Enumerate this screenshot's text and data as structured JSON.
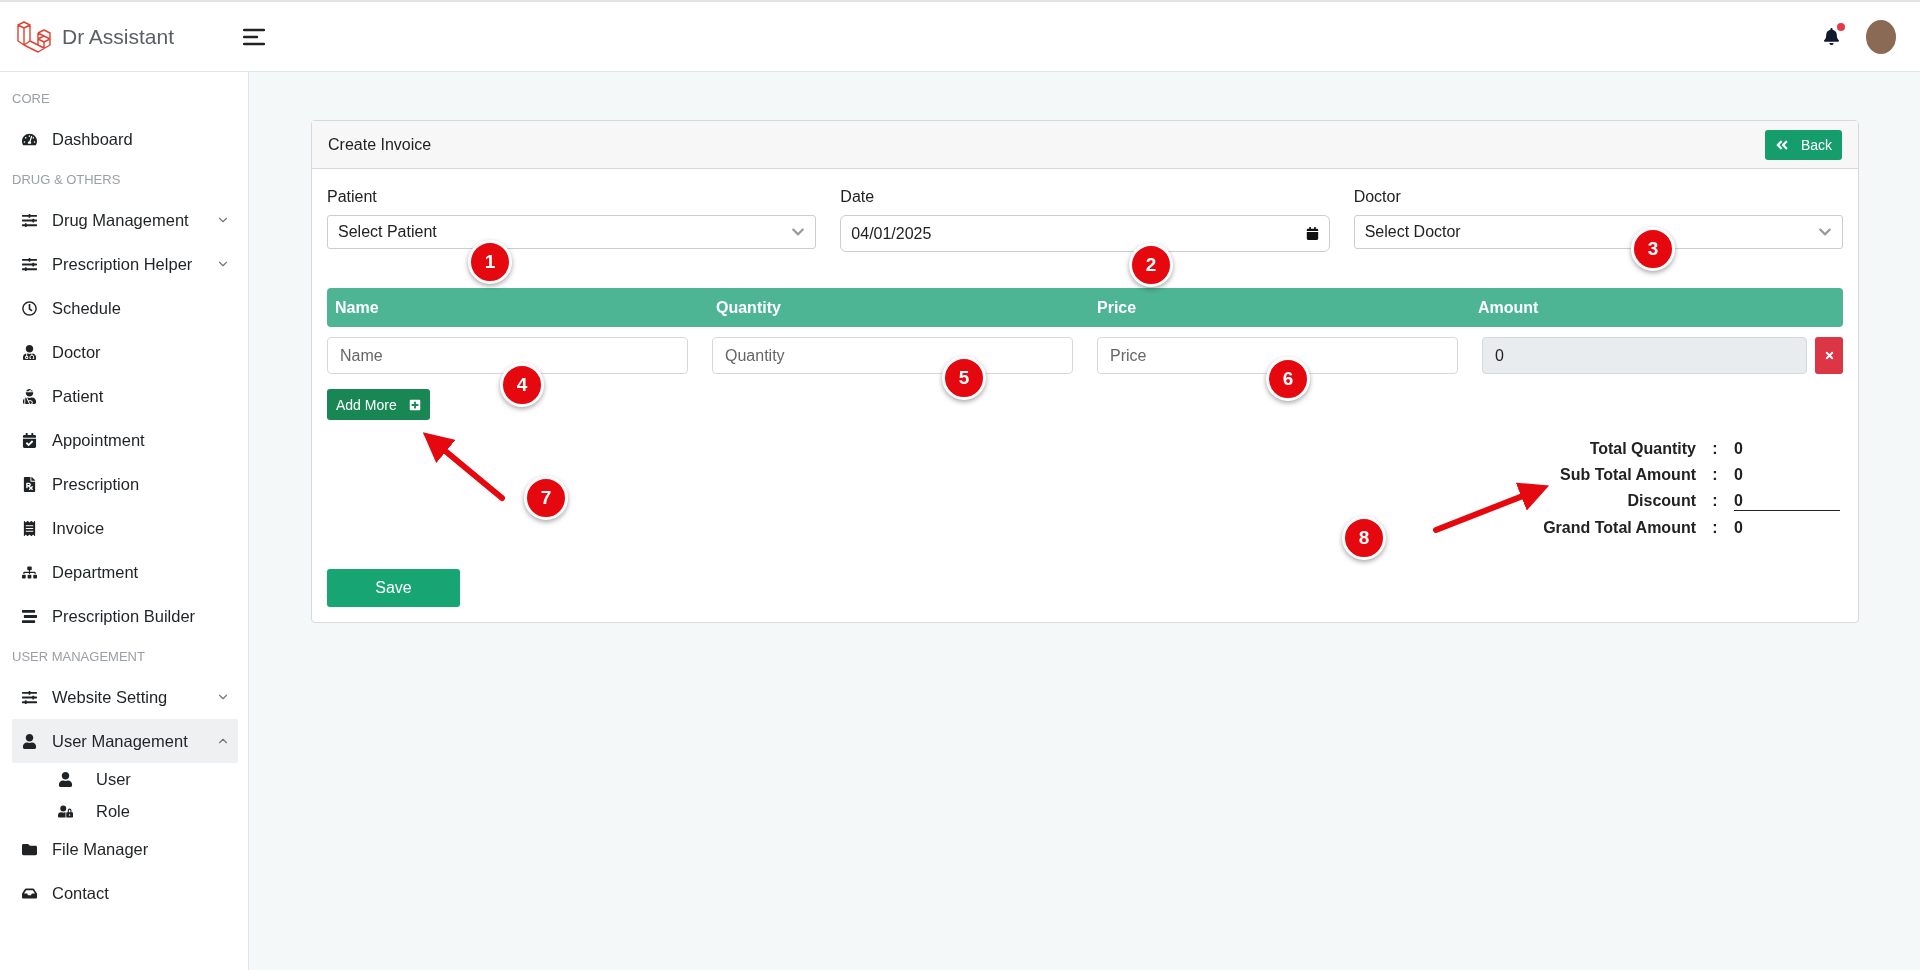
{
  "header": {
    "app_name": "Dr Assistant",
    "notification": true
  },
  "sidebar": [
    {
      "kind": "heading",
      "label": "CORE"
    },
    {
      "kind": "item",
      "label": "Dashboard",
      "selected": false
    },
    {
      "kind": "heading",
      "label": "DRUG & OTHERS"
    },
    {
      "kind": "item",
      "label": "Drug Management",
      "selected": false,
      "expanded": false
    },
    {
      "kind": "item",
      "label": "Prescription Helper",
      "selected": false,
      "expanded": false
    },
    {
      "kind": "item",
      "label": "Schedule",
      "selected": false
    },
    {
      "kind": "item",
      "label": "Doctor",
      "selected": false
    },
    {
      "kind": "item",
      "label": "Patient",
      "selected": false
    },
    {
      "kind": "item",
      "label": "Appointment",
      "selected": false
    },
    {
      "kind": "item",
      "label": "Prescription",
      "selected": false
    },
    {
      "kind": "item",
      "label": "Invoice",
      "selected": false
    },
    {
      "kind": "item",
      "label": "Department",
      "selected": false
    },
    {
      "kind": "item",
      "label": "Prescription Builder",
      "selected": false
    },
    {
      "kind": "heading",
      "label": "USER MANAGEMENT"
    },
    {
      "kind": "item",
      "label": "Website Setting",
      "selected": false,
      "expanded": false
    },
    {
      "kind": "item",
      "label": "User Management",
      "selected": true,
      "expanded": true,
      "children": [
        {
          "label": "User",
          "selected": false
        },
        {
          "label": "Role",
          "selected": false
        }
      ]
    },
    {
      "kind": "item",
      "label": "File Manager",
      "selected": false
    },
    {
      "kind": "item",
      "label": "Contact",
      "selected": false
    }
  ],
  "card": {
    "title": "Create Invoice",
    "back_button": "Back",
    "fields": [
      {
        "label": "Patient",
        "kind": "select",
        "value": "Select Patient"
      },
      {
        "label": "Date",
        "kind": "date",
        "value": "04/01/2025"
      },
      {
        "label": "Doctor",
        "kind": "select",
        "value": "Select Doctor"
      }
    ],
    "table": {
      "columns": [
        "Name",
        "Quantity",
        "Price",
        "Amount"
      ],
      "rows": [
        {
          "name_placeholder": "Name",
          "quantity_placeholder": "Quantity",
          "price_placeholder": "Price",
          "amount": "0"
        }
      ]
    },
    "add_more_button": "Add More",
    "totals": [
      {
        "label": "Total Quantity",
        "separator": ":",
        "value": "0",
        "kind": "text"
      },
      {
        "label": "Sub Total Amount",
        "separator": ":",
        "value": "0",
        "kind": "text"
      },
      {
        "label": "Discount",
        "separator": ":",
        "value": "0",
        "kind": "field"
      },
      {
        "label": "Grand Total Amount",
        "separator": ":",
        "value": "0",
        "kind": "text"
      }
    ],
    "save_button": "Save"
  },
  "annotations": [
    "1",
    "2",
    "3",
    "4",
    "5",
    "6",
    "7",
    "8"
  ]
}
